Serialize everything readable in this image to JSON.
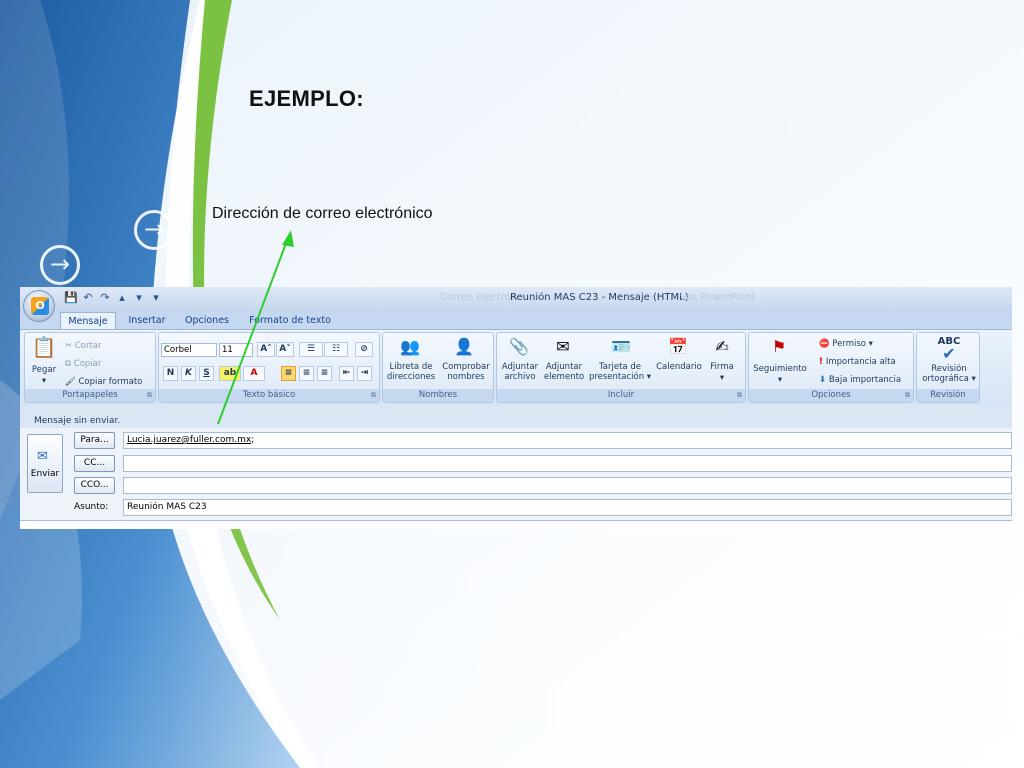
{
  "slide": {
    "title": "EJEMPLO:",
    "callout": "Dirección de correo electrónico"
  },
  "colors": {
    "callout_arrow": "#33cc33",
    "background_blue": "#2f6db1",
    "ribbon": "#dbe6f4",
    "accent_green": "#7cc242"
  },
  "window": {
    "title": "Reunión MAS C23 - Mensaje (HTML)",
    "ghost_left": "Correo electrón",
    "ghost_right": "vas PowerPoint",
    "office_button_icon": "office-logo-icon",
    "office_button_text": "O",
    "qat": [
      "💾",
      "↶",
      "↷",
      "▴",
      "▾",
      "▾"
    ]
  },
  "tabs": [
    "Mensaje",
    "Insertar",
    "Opciones",
    "Formato de texto"
  ],
  "ribbon": {
    "portapapeles": {
      "label": "Portapapeles",
      "paste": "Pegar",
      "cut": "Cortar",
      "copy": "Copiar",
      "format_painter": "Copiar formato"
    },
    "texto_basico": {
      "label": "Texto básico",
      "font": "Corbel",
      "size": "11",
      "bold": "N",
      "italic": "K",
      "underline": "S",
      "grow": "A˄",
      "shrink": "A˅"
    },
    "nombres": {
      "label": "Nombres",
      "address_book_1": "Libreta de",
      "address_book_2": "direcciones",
      "check_1": "Comprobar",
      "check_2": "nombres"
    },
    "incluir": {
      "label": "Incluir",
      "attach_file_1": "Adjuntar",
      "attach_file_2": "archivo",
      "attach_item_1": "Adjuntar",
      "attach_item_2": "elemento",
      "card_1": "Tarjeta de",
      "card_2": "presentación ▾",
      "calendar": "Calendario",
      "signature": "Firma"
    },
    "opciones": {
      "label": "Opciones",
      "followup": "Seguimiento",
      "permission": "Permiso ▾",
      "high": "Importancia alta",
      "low": "Baja importancia"
    },
    "revision": {
      "label": "Revisión",
      "spell_1": "Revisión",
      "spell_2": "ortográfica ▾",
      "abc": "ABC"
    }
  },
  "message": {
    "notice": "Mensaje sin enviar.",
    "send_label": "Enviar",
    "to_label": "Para...",
    "cc_label": "CC...",
    "bcc_label": "CCO...",
    "subject_label": "Asunto:",
    "to_value": "Lucia.juarez@fuller.com.mx",
    "to_suffix": ";",
    "cc_value": "",
    "bcc_value": "",
    "subject_value": "Reunión MAS C23"
  }
}
